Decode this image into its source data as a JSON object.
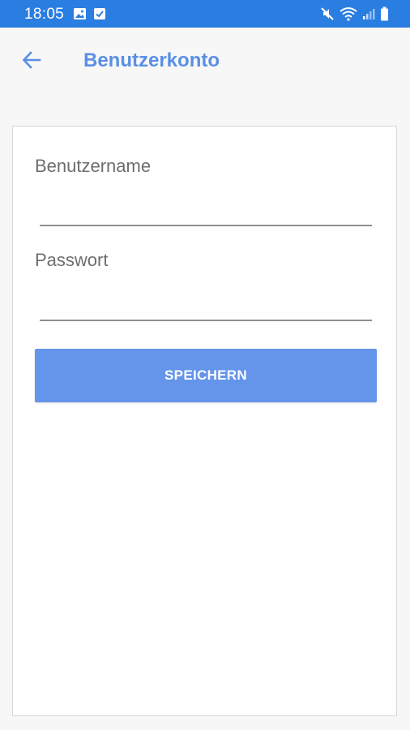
{
  "status_bar": {
    "time": "18:05",
    "icons_left": [
      "image-icon",
      "checkbox-icon"
    ],
    "icons_right": [
      "mute-icon",
      "wifi-icon",
      "signal-icon",
      "battery-icon"
    ],
    "color": "#2a7de1"
  },
  "app_bar": {
    "title": "Benutzerkonto",
    "back_icon": "arrow-left-icon",
    "title_color": "#5a8fe6"
  },
  "form": {
    "username": {
      "label": "Benutzername",
      "value": ""
    },
    "password": {
      "label": "Passwort",
      "value": ""
    },
    "save_label": "SPEICHERN",
    "button_color": "#6495ea"
  }
}
